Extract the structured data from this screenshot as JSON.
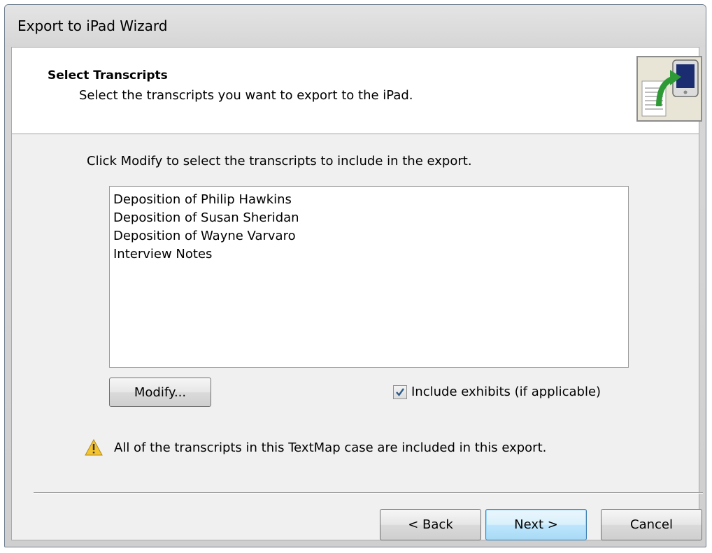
{
  "window": {
    "title": "Export to iPad Wizard"
  },
  "header": {
    "title": "Select Transcripts",
    "subtitle": "Select the transcripts you want to export to the iPad.",
    "icon": "export-to-ipad-icon"
  },
  "main": {
    "instruction": "Click Modify to select the transcripts to include in the export.",
    "transcripts": [
      "Deposition of Philip Hawkins",
      "Deposition of Susan Sheridan",
      "Deposition of Wayne Varvaro",
      "Interview Notes"
    ],
    "modify_label": "Modify...",
    "include_exhibits": {
      "label": "Include exhibits (if applicable)",
      "checked": true
    },
    "warning": {
      "icon": "warning-icon",
      "text": "All of the transcripts in this TextMap case are included in this export."
    }
  },
  "footer": {
    "back_label": "< Back",
    "next_label": "Next >",
    "cancel_label": "Cancel"
  },
  "colors": {
    "arrow_green": "#2e9a36",
    "ipad_screen": "#1b2d70",
    "warning_yellow": "#f4c430"
  }
}
